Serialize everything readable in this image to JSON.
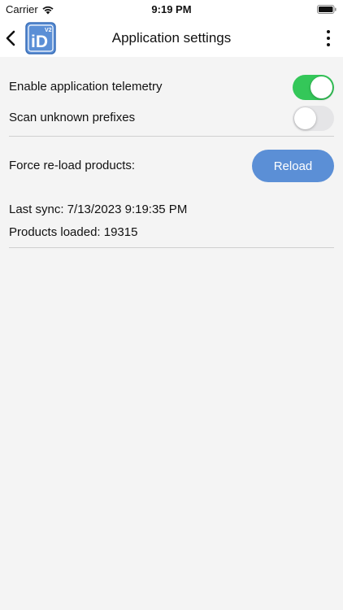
{
  "status_bar": {
    "carrier": "Carrier",
    "time": "9:19 PM"
  },
  "header": {
    "title": "Application settings",
    "logo_text": "iD",
    "logo_badge": "V2"
  },
  "settings": {
    "telemetry": {
      "label": "Enable application telemetry",
      "enabled": true
    },
    "scan_prefixes": {
      "label": "Scan unknown prefixes",
      "enabled": false
    },
    "force_reload": {
      "label": "Force re-load products:",
      "button_label": "Reload"
    }
  },
  "sync": {
    "last_sync": "Last sync: 7/13/2023 9:19:35 PM",
    "products_loaded": "Products loaded: 19315"
  },
  "colors": {
    "accent": "#5b8fd6",
    "toggle_on": "#34c759",
    "toggle_off": "#e5e5e7",
    "background": "#f4f4f4"
  }
}
